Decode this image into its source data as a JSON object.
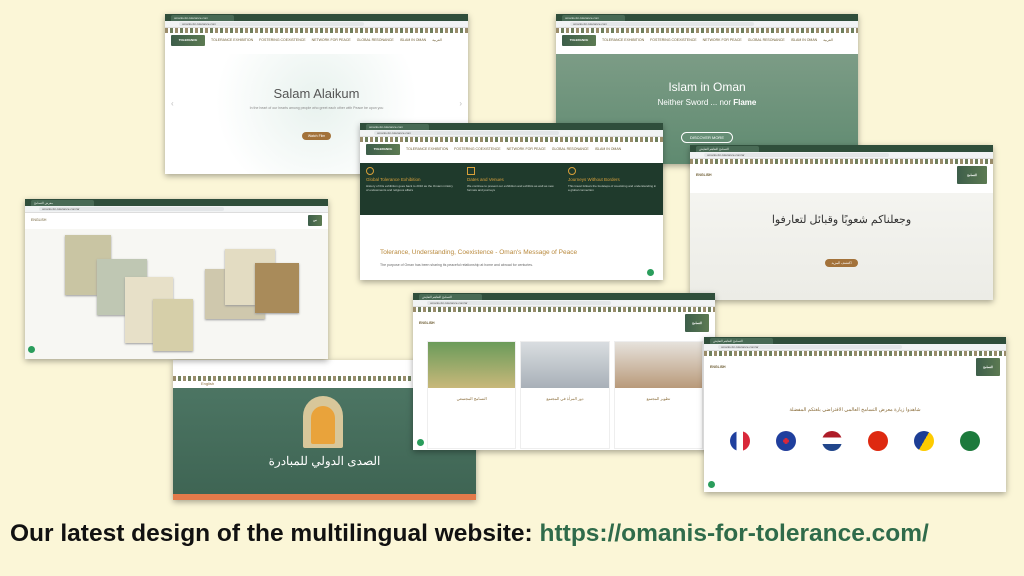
{
  "caption": {
    "prefix": "Our latest design of the multilingual website: ",
    "url": "https://omanis-for-tolerance.com/"
  },
  "nav_en": {
    "items": [
      "TOLERANCE EXHIBITION",
      "FOSTERING COEXISTENCE",
      "NETWORK FOR PEACE",
      "GLOBAL RESONANCE",
      "ISLAM IN OMAN",
      "العربية"
    ],
    "logo": "TOLERANCE UNDERSTANDING COEXISTENCE"
  },
  "shot1": {
    "heading": "Salam Alaikum",
    "body": "In the heart of our hearts among people who greet each other with Peace be upon you",
    "button": "Watch Film"
  },
  "shot2": {
    "heading": "Islam in Oman",
    "subheading_a": "Neither Sword ... nor ",
    "subheading_b": "Flame",
    "button": "DISCOVER MORE"
  },
  "shot3": {
    "cards": [
      {
        "title": "Global Tolerance Exhibition",
        "text": "History of this exhibition goes back to 2010 as the Omani ministry of endowments and religious affairs"
      },
      {
        "title": "Dates and Venues",
        "text": "We continue to present our exhibition and exhibits as well as new formats and journeys"
      },
      {
        "title": "Journeys Without Borders",
        "text": "This travel follows the footsteps of coexisting and understanding in a global connection"
      }
    ],
    "heading": "Tolerance, Understanding, Coexistence - Oman's Message of Peace",
    "text": "The purpose of Oman has been sharing its peaceful relationship at home and abroad for centuries."
  },
  "shot4": {
    "heading": "وجعلناكم شعوبًا وقبائل لتعارفوا",
    "button": "اكتشف المزيد",
    "lang": "ENGLISH"
  },
  "shot5": {
    "lang": "ENGLISH"
  },
  "shot6": {
    "title": "الصدى الدولي للمبادرة",
    "lang": "English"
  },
  "shot7": {
    "lang": "ENGLISH",
    "cards": [
      "التسامح المجتمعي",
      "دور المرأة في المجتمع",
      "تطوير المجتمع"
    ]
  },
  "shot8": {
    "lang": "ENGLISH",
    "heading": "شاهدوا زيارة معرض التسامح العالمي الافتراضي بلغتكم المفضلة"
  },
  "colors": {
    "background": "#fbf6d7",
    "green_dark": "#2f4e3b",
    "accent_brown": "#a3723a",
    "link": "#2f6b4a"
  }
}
